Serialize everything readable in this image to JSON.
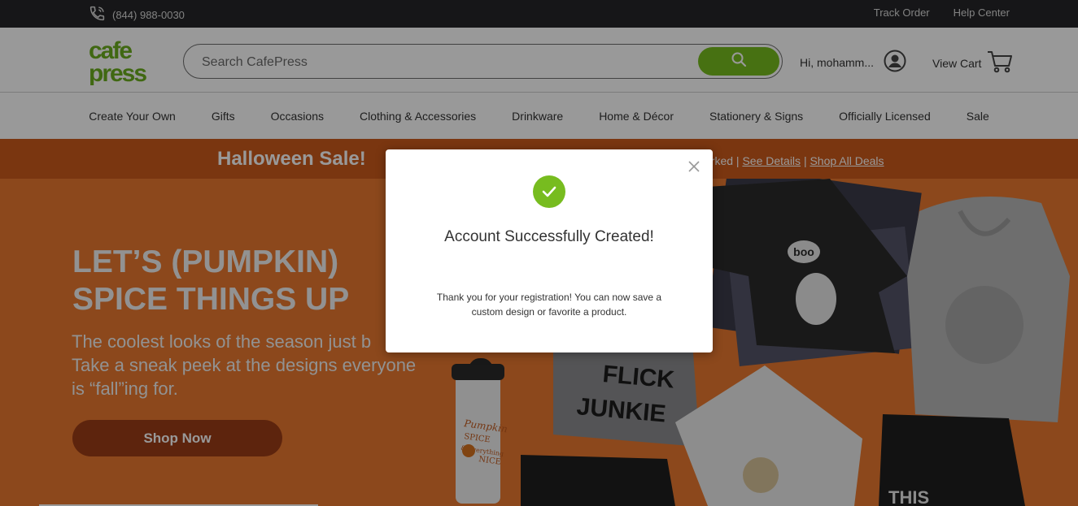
{
  "topbar": {
    "phone": "(844) 988-0030",
    "links": [
      "Track Order",
      "Help Center"
    ]
  },
  "header": {
    "logo_text": "cafepress",
    "search_placeholder": "Search CafePress",
    "account_greeting": "Hi, mohamm...",
    "cart_label": "View Cart"
  },
  "nav": {
    "items": [
      "Create Your Own",
      "Gifts",
      "Occasions",
      "Clothing & Accessories",
      "Drinkware",
      "Home & Décor",
      "Stationery & Signs",
      "Officially Licensed",
      "Sale"
    ]
  },
  "promo": {
    "title": "Halloween Sale!",
    "partial_text": "arked",
    "see_details": "See Details",
    "shop_all": "Shop All Deals",
    "separator": "|"
  },
  "hero": {
    "headline_line1": "LET’S (PUMPKIN)",
    "headline_line2": "SPICE THINGS UP",
    "sub_line1": "The coolest looks of the season just b",
    "sub_line2": "Take a sneak peek at the designs everyone",
    "sub_line3": "is “fall”ing for.",
    "cta": "Shop Now"
  },
  "art": {
    "mug_text1": "Pumpkin",
    "mug_text2": "SPICE",
    "mug_text3": "& everything",
    "mug_text4": "NICE",
    "shirt_text1": "FLICK",
    "shirt_text2": "JUNKIE",
    "boo": "boo",
    "bottom_shirt": "THIS"
  },
  "modal": {
    "title": "Account Successfully Created!",
    "body_line1": "Thank you for your registration! You can now save a",
    "body_line2": "custom design or favorite a product."
  },
  "colors": {
    "brand_green": "#77bc1f",
    "promo_orange": "#cc5a1c",
    "hero_orange": "#e9792f",
    "cta_brown": "#9b3d16",
    "topbar": "#252628"
  }
}
